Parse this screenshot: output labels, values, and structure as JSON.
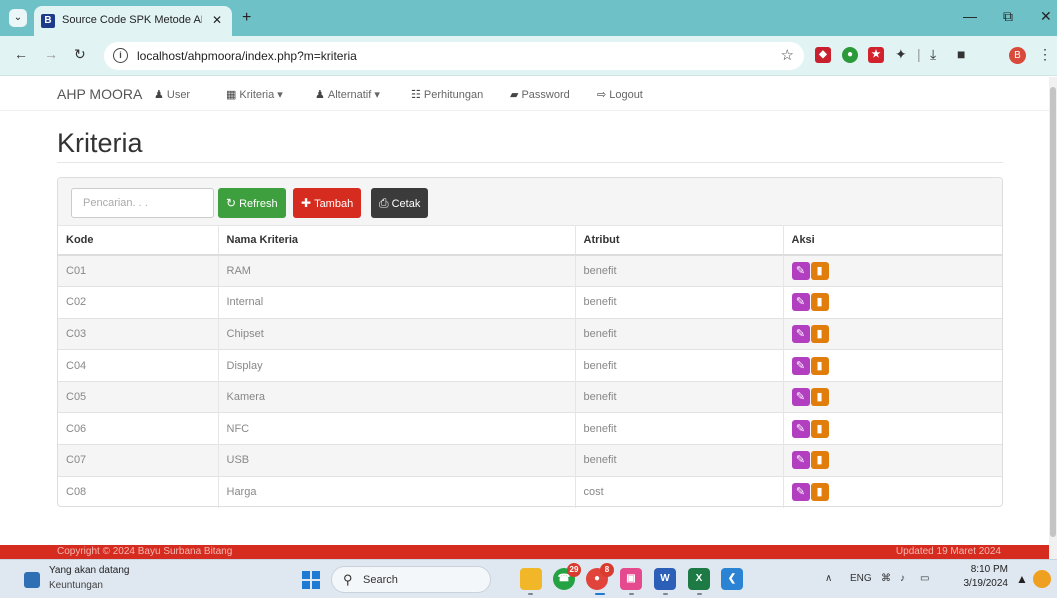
{
  "browser": {
    "tab_title": "Source Code SPK Metode AHP",
    "tab_favicon": "B",
    "new_tab": "+",
    "url": "localhost/ahpmoora/index.php?m=kriteria",
    "profile_initial": "B"
  },
  "nav": {
    "brand": "AHP MOORA",
    "items": [
      {
        "label": "User",
        "icon": "user-icon",
        "glyph": "♟"
      },
      {
        "label": "Kriteria ▾",
        "icon": "grid-icon",
        "glyph": "▦"
      },
      {
        "label": "Alternatif ▾",
        "icon": "user-icon",
        "glyph": "♟"
      },
      {
        "label": "Perhitungan",
        "icon": "calculator-icon",
        "glyph": "☷"
      },
      {
        "label": "Password",
        "icon": "lock-icon",
        "glyph": "▰"
      },
      {
        "label": "Logout",
        "icon": "logout-icon",
        "glyph": "⇨"
      }
    ]
  },
  "page": {
    "heading": "Kriteria",
    "search_placeholder": "Pencarian. . .",
    "buttons": {
      "refresh": "Refresh",
      "tambah": "Tambah",
      "cetak": "Cetak"
    },
    "table": {
      "headers": [
        "Kode",
        "Nama Kriteria",
        "Atribut",
        "Aksi"
      ],
      "rows": [
        [
          "C01",
          "RAM",
          "benefit"
        ],
        [
          "C02",
          "Internal",
          "benefit"
        ],
        [
          "C03",
          "Chipset",
          "benefit"
        ],
        [
          "C04",
          "Display",
          "benefit"
        ],
        [
          "C05",
          "Kamera",
          "benefit"
        ],
        [
          "C06",
          "NFC",
          "benefit"
        ],
        [
          "C07",
          "USB",
          "benefit"
        ],
        [
          "C08",
          "Harga",
          "cost"
        ]
      ]
    }
  },
  "footer": {
    "left": "Copyright © 2024 Bayu Surbana Bitang",
    "right": "Updated 19 Maret 2024"
  },
  "taskbar": {
    "weather_title": "Yang akan datang",
    "weather_sub": "Keuntungan",
    "search_label": "Search",
    "whatsapp_badge": "29",
    "chrome_badge": "8",
    "lang": "ENG",
    "time": "8:10 PM",
    "date": "3/19/2024"
  },
  "colors": {
    "accent_teal": "#6fc1c8",
    "refresh_green": "#3e9f3e",
    "tambah_red": "#d62b1f",
    "cetak_dark": "#3b3b3b",
    "edit_purple": "#b13fbf",
    "delete_orange": "#e07d0c",
    "footer_red": "#d62b1f"
  }
}
